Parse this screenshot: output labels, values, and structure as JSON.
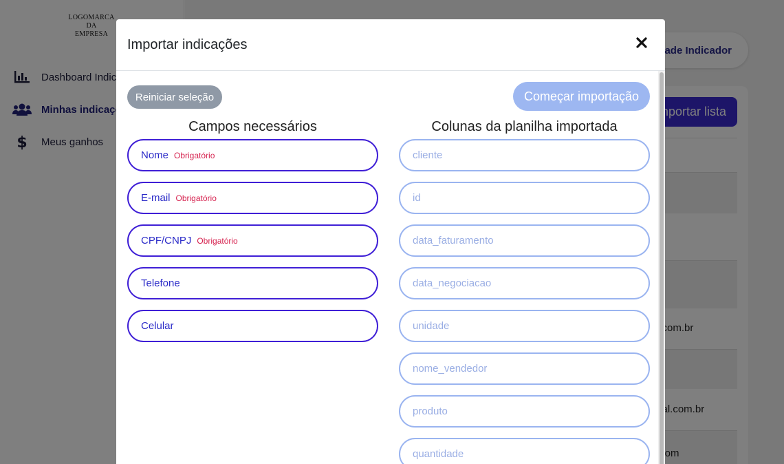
{
  "app": {
    "logo_lines": [
      "LOGOMARCA",
      "DA",
      "EMPRESA"
    ],
    "sidebar": {
      "items": [
        {
          "label": "Dashboard Indicador",
          "icon": "bar-chart-icon",
          "active": false
        },
        {
          "label": "Minhas indicações",
          "icon": "users-icon",
          "active": true
        },
        {
          "label": "Meus ganhos",
          "icon": "dollar-icon",
          "active": false
        }
      ]
    },
    "header_button_label": "Cadastrar Unidade Indicador",
    "import_list_label": "Importar lista",
    "table_rows": [
      "m",
      "",
      "",
      "i.com.br",
      "",
      "ital.com.br",
      ".com"
    ]
  },
  "modal": {
    "title": "Importar indicações",
    "close_icon": "close-icon",
    "reset_label": "Reiniciar seleção",
    "start_label": "Começar importação",
    "required_fields_title": "Campos necessários",
    "sheet_columns_title": "Colunas da planilha importada",
    "required_badge": "Obrigatório",
    "required_fields": [
      {
        "name": "Nome",
        "required_label": "Obrigatório"
      },
      {
        "name": "E-mail",
        "required_label": "Obrigatório"
      },
      {
        "name": "CPF/CNPJ",
        "required_label": "Obrigatório"
      },
      {
        "name": "Telefone",
        "required_label": ""
      },
      {
        "name": "Celular",
        "required_label": ""
      }
    ],
    "sheet_columns": [
      "cliente",
      "id",
      "data_faturamento",
      "data_negociacao",
      "unidade",
      "nome_vendedor",
      "produto",
      "quantidade"
    ]
  },
  "colors": {
    "accent": "#3f1fd6",
    "accent_light": "#9db7f1",
    "required": "#d6224f",
    "reset_button": "#8f99a6"
  }
}
